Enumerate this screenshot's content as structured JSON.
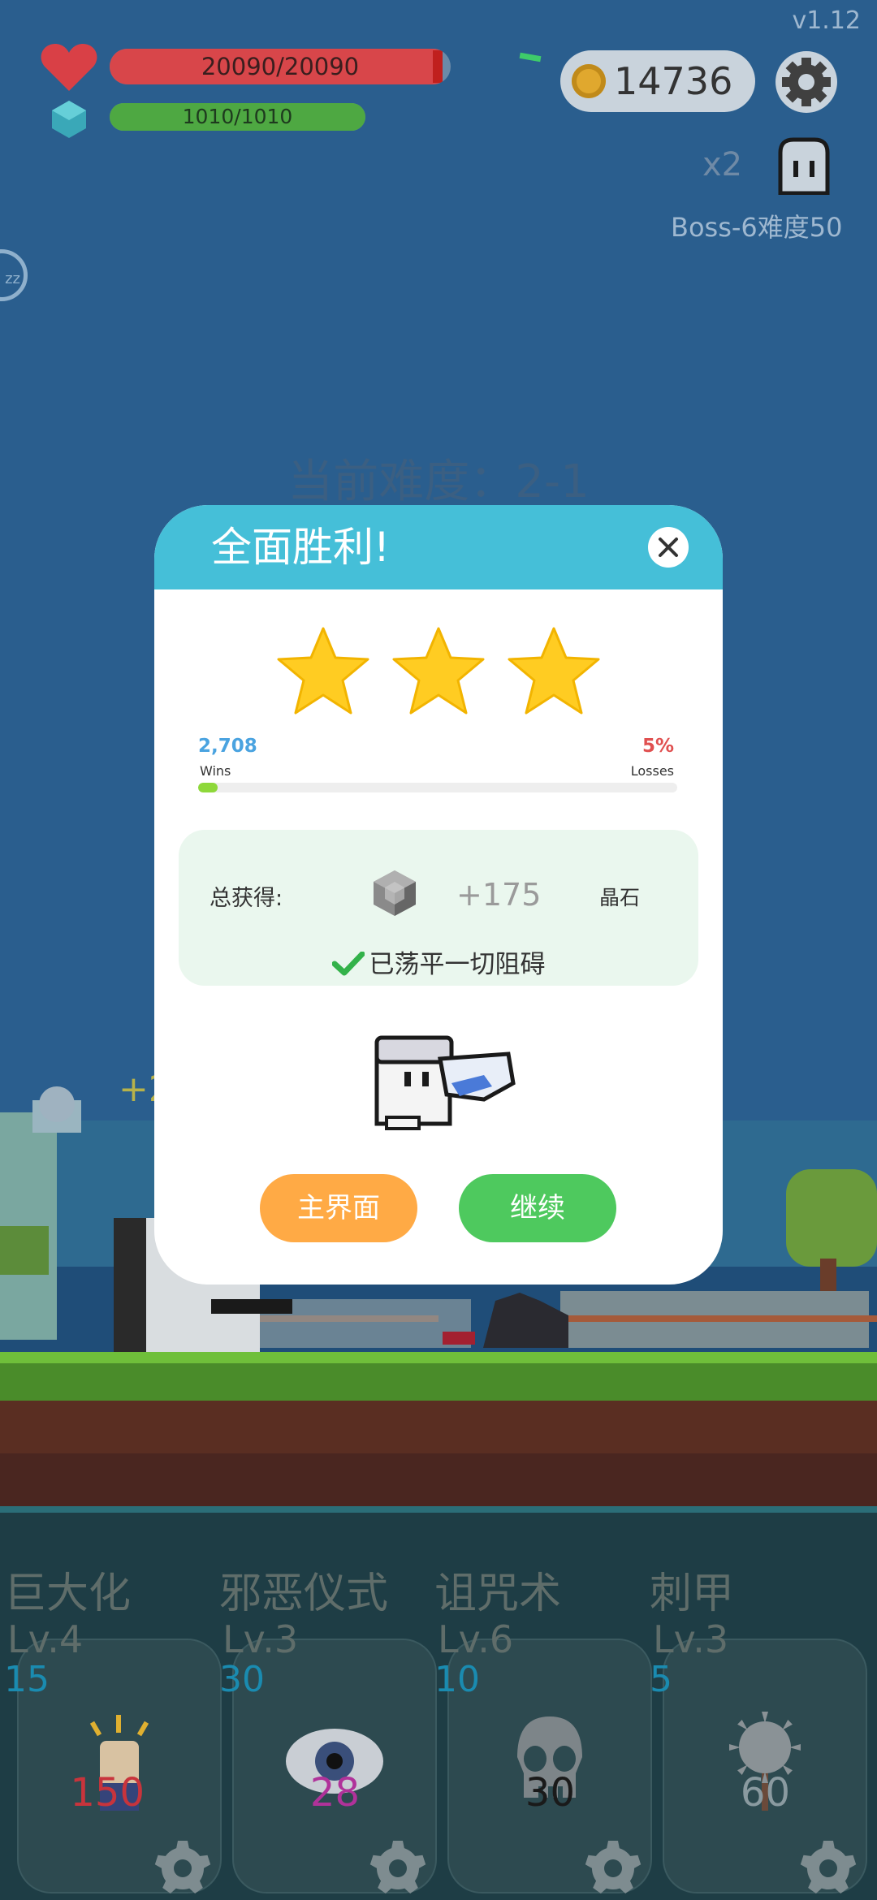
{
  "hud": {
    "version": "v1.12",
    "hp_text": "20090/20090",
    "hp_fraction": 1.0,
    "mana_text": "1010/1010",
    "mana_fraction": 1.0,
    "coins": "14736",
    "multiplier": "x2",
    "boss_label": "Boss-6难度50",
    "sleep_label": "zz"
  },
  "stage": {
    "difficulty_text": "当前难度：2-1",
    "float_text": "+2"
  },
  "modal": {
    "title": "全面胜利!",
    "stars_earned": 3,
    "stars_total": 3,
    "wins_value": "2,708",
    "wins_label": "Wins",
    "losses_value": "5%",
    "losses_label": "Losses",
    "win_progress_fraction": 0.04,
    "reward_label": "总获得:",
    "reward_amount": "+175",
    "reward_unit": "晶石",
    "cleared_text": "已荡平一切阻碍",
    "home_button": "主界面",
    "continue_button": "继续"
  },
  "skills": [
    {
      "name": "巨大化",
      "level": "Lv.4",
      "cost": "15",
      "count": "150",
      "count_color": "#c8343c",
      "icon": "fist-icon"
    },
    {
      "name": "邪恶仪式",
      "level": "Lv.3",
      "cost": "30",
      "count": "28",
      "count_color": "#b0329a",
      "icon": "eye-icon"
    },
    {
      "name": "诅咒术",
      "level": "Lv.6",
      "cost": "10",
      "count": "30",
      "count_color": "#1a1a1a",
      "icon": "skull-icon"
    },
    {
      "name": "刺甲",
      "level": "Lv.3",
      "cost": "5",
      "count": "60",
      "count_color": "#8a9aa0",
      "icon": "spiked-mace-icon"
    }
  ],
  "colors": {
    "modal_header": "#45bfd8",
    "home_button": "#ffaa45",
    "continue_button": "#4ec95e",
    "star": "#ffcc22"
  }
}
